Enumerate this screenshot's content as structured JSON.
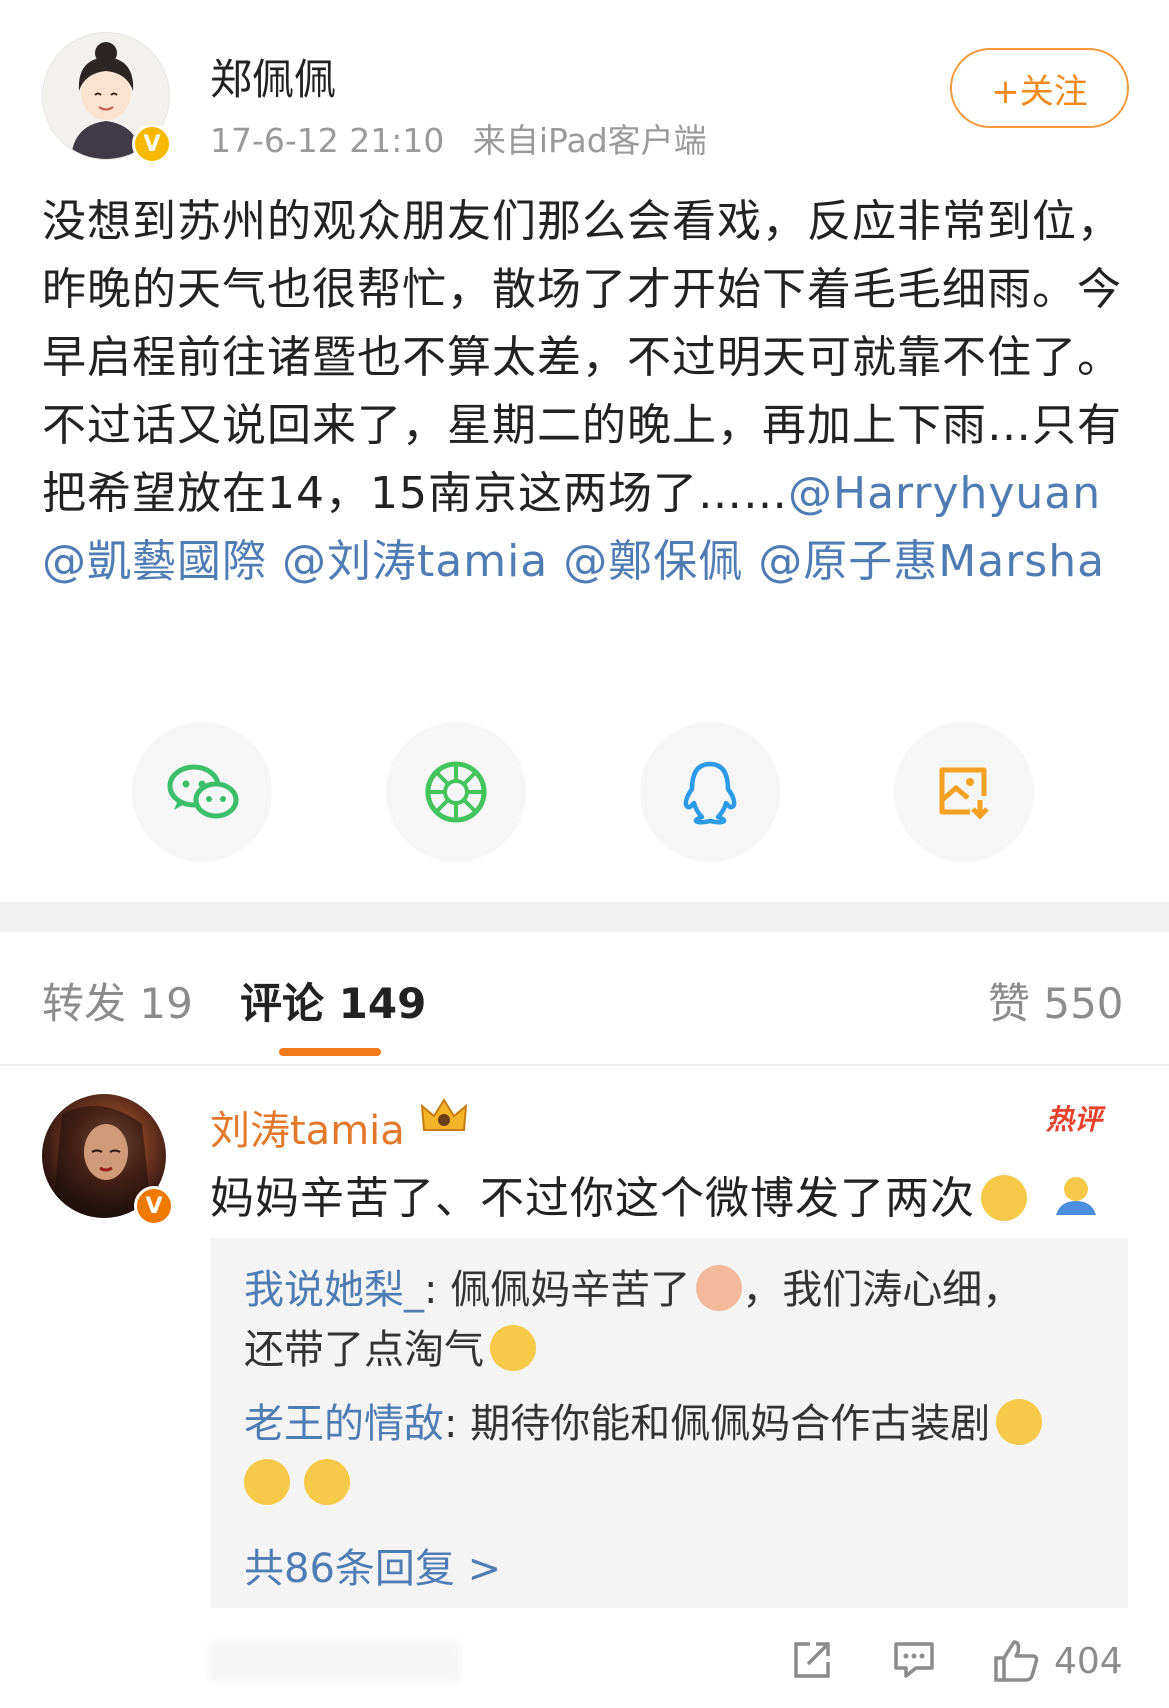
{
  "post": {
    "author": "郑佩佩",
    "time": "17-6-12 21:10",
    "source": "来自iPad客户端",
    "follow_label": "+关注",
    "text": "没想到苏州的观众朋友们那么会看戏，反应非常到位，昨晚的天气也很帮忙，散场了才开始下着毛毛细雨。今早启程前往诸暨也不算太差，不过明天可就靠不住了。不过话又说回来了，星期二的晚上，再加上下雨…只有把希望放在14，15南京这两场了……",
    "mentions": [
      "@Harryhyuan",
      "@凱藝國際",
      "@刘涛tamia",
      "@鄭保佩",
      "@原子惠Marsha"
    ]
  },
  "share": {
    "items": [
      {
        "name": "wechat",
        "icon": "wechat-icon",
        "color": "#3cbf6a"
      },
      {
        "name": "moments",
        "icon": "moments-icon",
        "color": "#44c45d"
      },
      {
        "name": "qq",
        "icon": "qq-icon",
        "color": "#2b9be8"
      },
      {
        "name": "save-image",
        "icon": "save-image-icon",
        "color": "#f4a023"
      }
    ]
  },
  "tabs": {
    "repost": "转发 19",
    "comments": "评论 149",
    "likes": "赞 550"
  },
  "comment": {
    "author": "刘涛tamia",
    "hot_label": "热评",
    "text": "妈妈辛苦了、不过你这个微博发了两次",
    "replies": [
      {
        "who": "我说她梨_",
        "text": ": 佩佩妈辛苦了",
        "text2": "，我们涛心细，",
        "text3": "还带了点淘气"
      },
      {
        "who": "老王的情敌",
        "text": ": 期待你能和佩佩妈合作古装剧"
      }
    ],
    "more_replies": "共86条回复 >",
    "like_count": "404"
  },
  "colors": {
    "accent": "#f27a1a",
    "link": "#4f7db3",
    "hot": "#e6432f"
  }
}
